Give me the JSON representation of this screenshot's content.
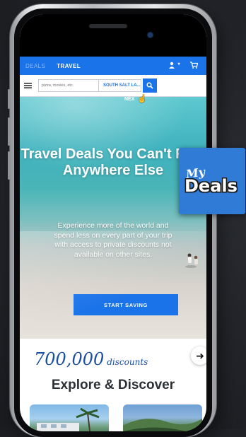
{
  "nav": {
    "tabs": [
      {
        "label": "DEALS",
        "active": false
      },
      {
        "label": "TRAVEL",
        "active": true
      }
    ],
    "icons": [
      "user-icon",
      "chevron-down-icon",
      "cart-icon"
    ]
  },
  "search": {
    "placeholder": "pizza, movies, etc.",
    "location": "SOUTH SALT LA...",
    "overlay_text": "NEX"
  },
  "hero": {
    "headline": "Travel Deals You Can't Find Anywhere Else",
    "subtext": "Experience more of the world and spend less on every part of your trip with access to private discounts not available on other sites.",
    "cta_label": "START SAVING"
  },
  "stats": {
    "count": "700,000",
    "word": "discounts"
  },
  "explore": {
    "title": "Explore & Discover"
  },
  "logo": {
    "my": "My",
    "deals": "Deals"
  },
  "colors": {
    "primary": "#1a73e8",
    "background": "#24262b",
    "script": "#1a4fa3"
  }
}
